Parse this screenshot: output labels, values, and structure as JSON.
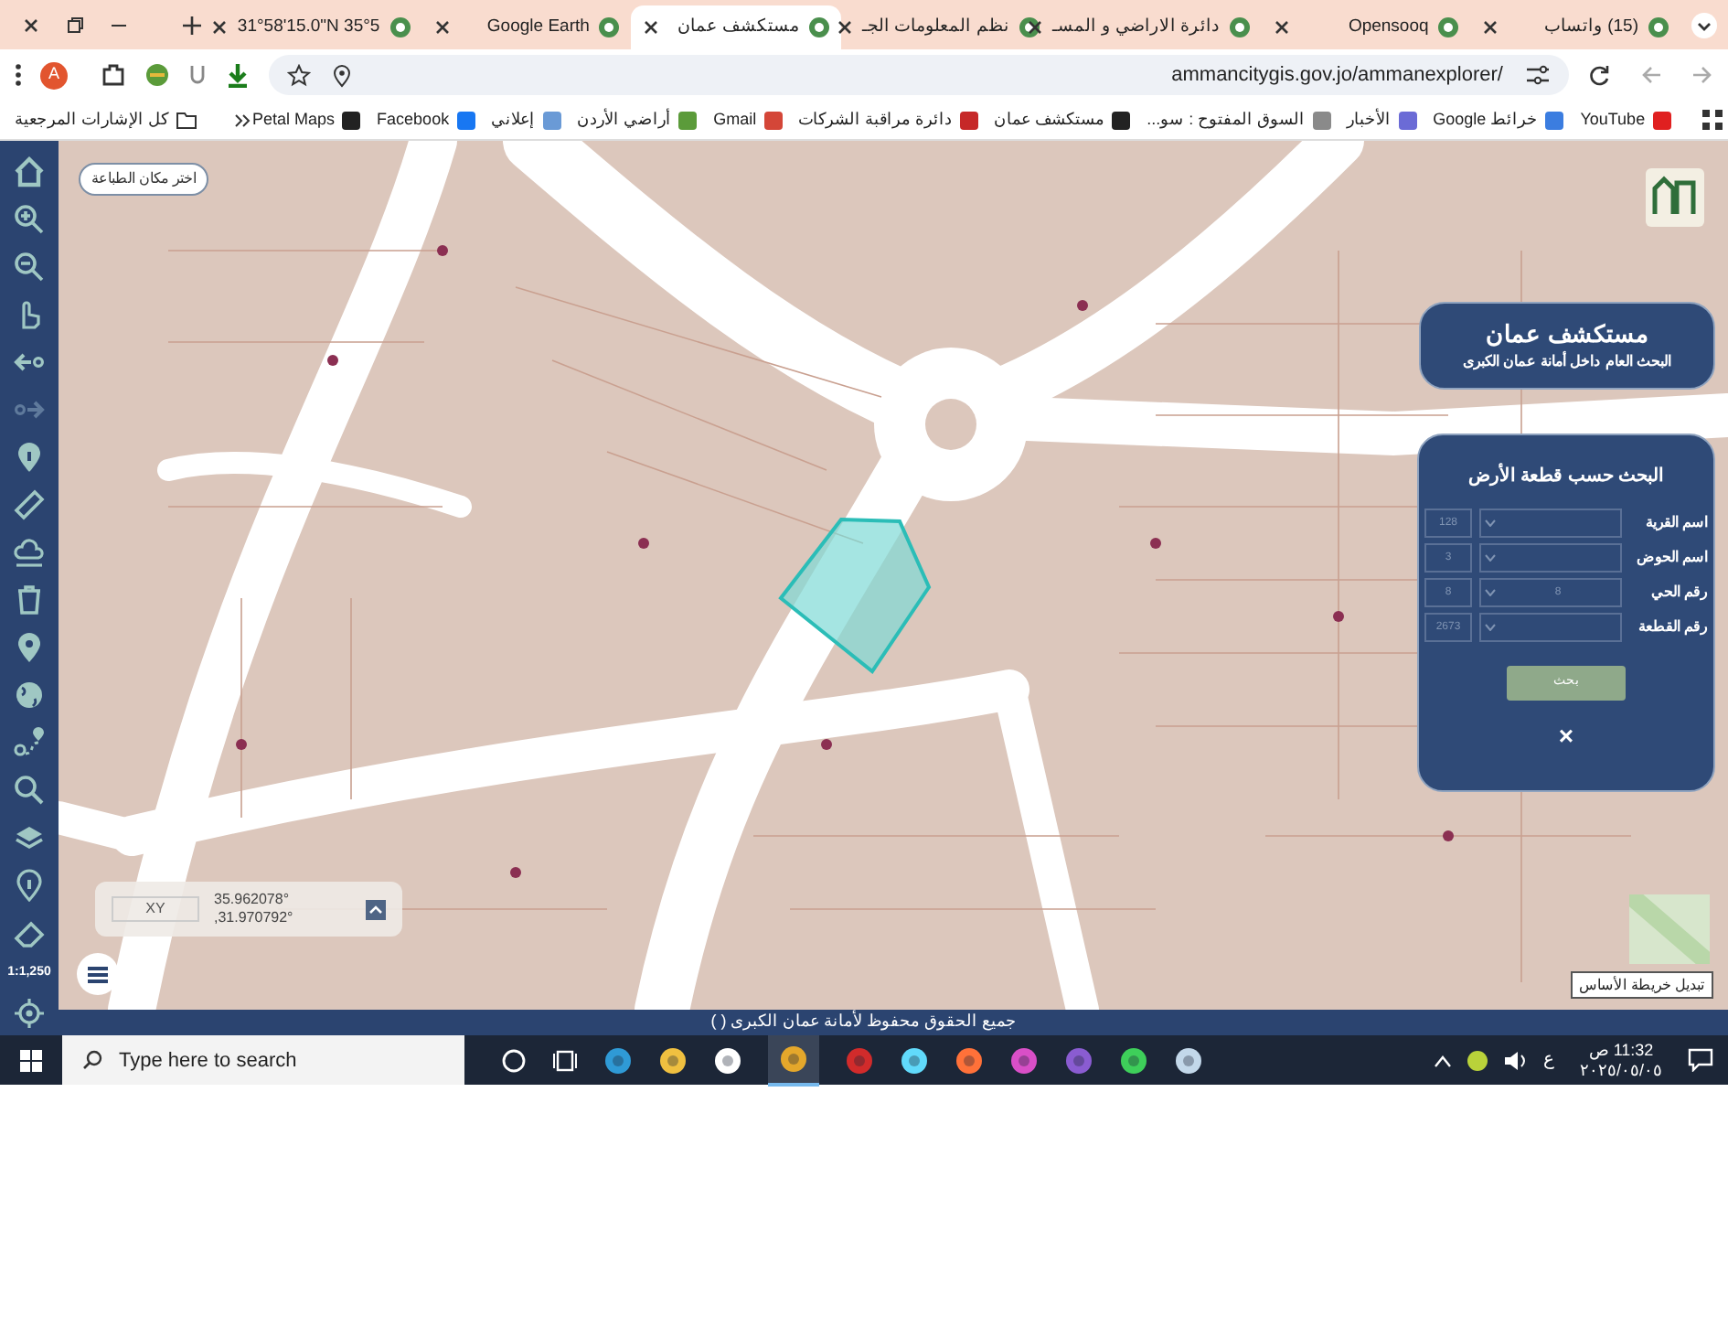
{
  "tabs": [
    {
      "title": "(15) واتساب",
      "selected": false
    },
    {
      "title": "Opensooq",
      "selected": false
    },
    {
      "title": "دائرة الاراضي و المسـ",
      "selected": false
    },
    {
      "title": "نظم المعلومات الجـ",
      "selected": false
    },
    {
      "title": "مستكشف عمان",
      "selected": true
    },
    {
      "title": "Google Earth",
      "selected": false
    },
    {
      "title": "31°58'15.0\"N 35°5",
      "selected": false
    }
  ],
  "address_bar": {
    "url": "ammancitygis.gov.jo/ammanexplorer/",
    "avatar": "A"
  },
  "bookmarks": [
    "YouTube",
    "خرائط Google",
    "الأخبار",
    "السوق المفتوح : سو...",
    "مستكشف عمان",
    "دائرة مراقبة الشركات",
    "Gmail",
    "أراضي الأردن",
    "إعلاني",
    "Facebook",
    "Petal Maps"
  ],
  "all_bookmarks": "كل الإشارات المرجعية",
  "map": {
    "print_button": "اختر مكان الطباعة",
    "explorer_panel": {
      "title": "مستكشف عمان",
      "subtitle": "البحث العام داخل أمانة عمان الكبرى"
    },
    "parcel_search": {
      "title": "البحث حسب قطعة الأرض",
      "fields": [
        {
          "label": "اسم القرية",
          "code": "128"
        },
        {
          "label": "اسم الحوض",
          "code": "3"
        },
        {
          "label": "رقم الحي",
          "code": "8",
          "select_value": "8"
        },
        {
          "label": "رقم القطعة",
          "code": "2673"
        }
      ],
      "button": "بحث",
      "close": "×"
    },
    "coordinates": {
      "label": "XY",
      "x": "35.962078°",
      "y": ",31.970792°"
    },
    "scale": "1:1,250",
    "basemap_toggle": "تبديل خريطة الأساس"
  },
  "footer": "جميع الحقوق محفوظ لأمانة عمان الكبرى ( )",
  "taskbar": {
    "search_placeholder": "Type here to search",
    "language": "ع",
    "time": "11:32 ص",
    "date": "٢٠٢٥/٠٥/٠٥"
  }
}
